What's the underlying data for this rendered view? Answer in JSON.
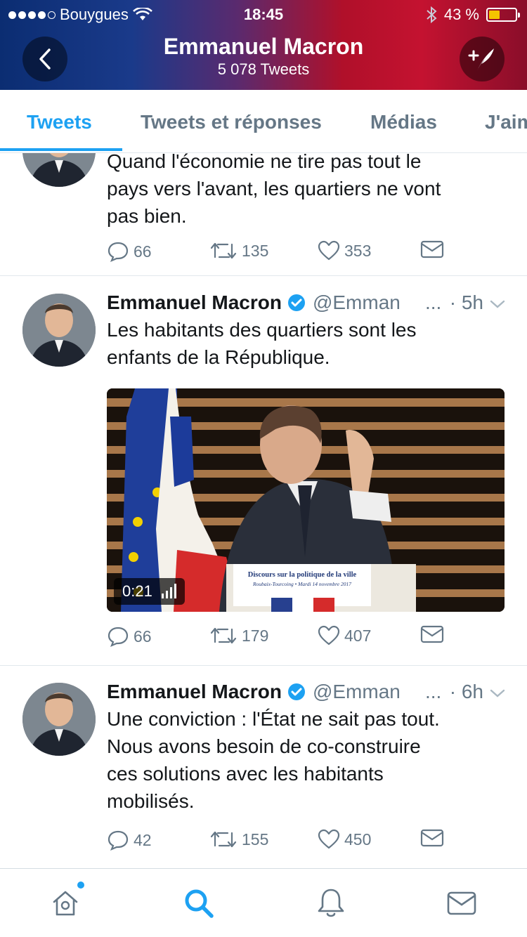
{
  "status_bar": {
    "carrier": "Bouygues",
    "time": "18:45",
    "battery_text": "43 %",
    "battery_level": 0.43
  },
  "header": {
    "title": "Emmanuel Macron",
    "subtitle": "5 078 Tweets"
  },
  "tabs": [
    {
      "label": "Tweets",
      "active": true
    },
    {
      "label": "Tweets et réponses",
      "active": false
    },
    {
      "label": "Médias",
      "active": false
    },
    {
      "label": "J'aim",
      "active": false
    }
  ],
  "tweets": [
    {
      "text_lines": [
        "Quand l'économie ne tire pas tout le",
        "pays vers l'avant, les quartiers ne vont",
        "pas bien."
      ],
      "replies": "66",
      "retweets": "135",
      "likes": "353"
    },
    {
      "author": "Emmanuel Macron",
      "handle": "@Emman",
      "time": "· 5h",
      "text_lines": [
        "Les habitants des quartiers sont les",
        "enfants de la République."
      ],
      "media": {
        "sign_title": "Discours sur la politique de la ville",
        "sign_sub": "Roubaix-Tourcoing • Mardi 14 novembre 2017",
        "duration": "0:21"
      },
      "replies": "66",
      "retweets": "179",
      "likes": "407"
    },
    {
      "author": "Emmanuel Macron",
      "handle": "@Emman",
      "time": "· 6h",
      "text_lines": [
        "Une conviction : l'État ne sait pas tout.",
        "Nous avons besoin de co-construire",
        "ces solutions avec les habitants",
        "mobilisés."
      ],
      "replies": "42",
      "retweets": "155",
      "likes": "450"
    }
  ],
  "ellipsis": "...",
  "colors": {
    "accent": "#1da1f2",
    "text": "#14171a",
    "muted": "#657786"
  },
  "bottom_bar": [
    "home-icon",
    "search-icon",
    "notifications-icon",
    "messages-icon"
  ]
}
